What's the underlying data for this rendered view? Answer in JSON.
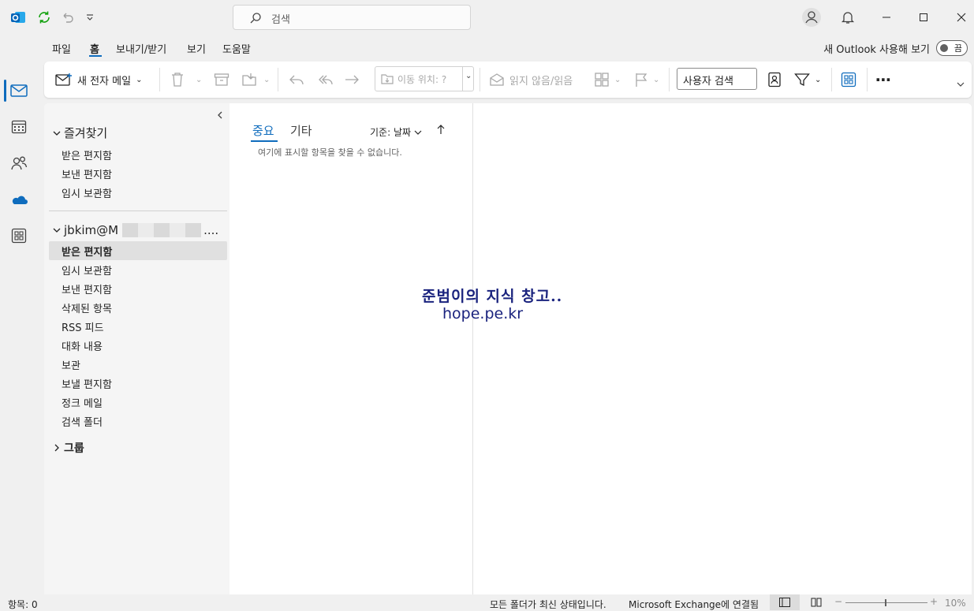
{
  "titlebar": {
    "search_placeholder": "검색"
  },
  "menu": {
    "tabs": [
      "파일",
      "홈",
      "보내기/받기",
      "보기",
      "도움말"
    ],
    "active_tab": "홈",
    "new_outlook_label": "새 Outlook 사용해 보기",
    "toggle_label": "끔"
  },
  "ribbon": {
    "new_mail": "새 전자 메일",
    "move_to": "이동 위치: ?",
    "read_unread": "읽지 않음/읽음",
    "people_search": "사용자 검색"
  },
  "folders": {
    "favorites_header": "즐겨찾기",
    "favorites": [
      "받은 편지함",
      "보낸 편지함",
      "임시 보관함"
    ],
    "account": "jbkim@M",
    "account_suffix": "....",
    "account_folders": [
      "받은 편지함",
      "임시 보관함",
      "보낸 편지함",
      "삭제된 항목",
      "RSS 피드",
      "대화 내용",
      "보관",
      "보낼 편지함",
      "정크 메일",
      "검색 폴더"
    ],
    "selected_folder": "받은 편지함",
    "groups_header": "그룹"
  },
  "message_list": {
    "tab_focused": "중요",
    "tab_other": "기타",
    "sort_label": "기준: 날짜",
    "empty_message": "여기에 표시할 항목을 찾을 수 없습니다."
  },
  "watermark": {
    "line1": "준범이의 지식 창고..",
    "line2": "hope.pe.kr"
  },
  "statusbar": {
    "items_count": "항목: 0",
    "sync_status": "모든 폴더가 최신 상태입니다.",
    "connection": "Microsoft Exchange에 연결됨",
    "zoom": "10%"
  },
  "colors": {
    "accent": "#0f6cbd",
    "outlook_blue": "#0364b8",
    "sync_green": "#13a10e",
    "watermark": "#1a237e"
  }
}
